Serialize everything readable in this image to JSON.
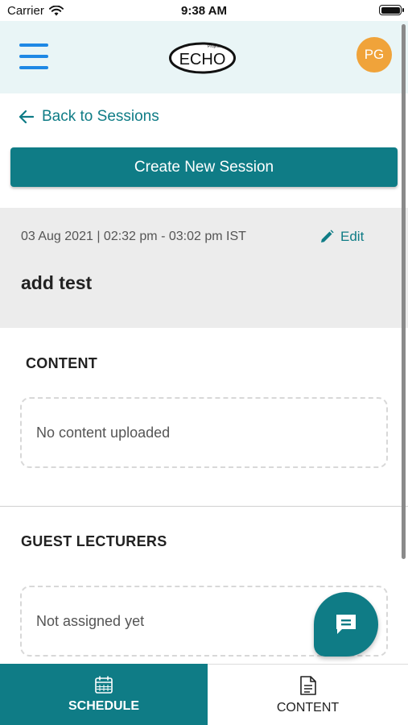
{
  "status_bar": {
    "carrier": "Carrier",
    "time": "9:38 AM"
  },
  "header": {
    "logo_small": "Project",
    "logo_text": "ECHO",
    "avatar_initials": "PG"
  },
  "back_link": {
    "label": "Back to Sessions"
  },
  "create_button": {
    "label": "Create New Session"
  },
  "session": {
    "datetime": "03 Aug 2021 | 02:32 pm - 03:02 pm IST",
    "edit_label": "Edit",
    "title": "add test"
  },
  "content_section": {
    "title": "CONTENT",
    "empty_text": "No content uploaded"
  },
  "guest_section": {
    "title": "GUEST LECTURERS",
    "empty_text": "Not assigned yet"
  },
  "tabs": [
    {
      "label": "SCHEDULE",
      "icon": "calendar-icon",
      "active": true
    },
    {
      "label": "CONTENT",
      "icon": "document-icon",
      "active": false
    }
  ],
  "colors": {
    "accent": "#0f7c86",
    "header_bg": "#e9f5f6",
    "avatar": "#f0a33a",
    "menu_icon": "#1e88e5",
    "session_bg": "#ececec"
  }
}
